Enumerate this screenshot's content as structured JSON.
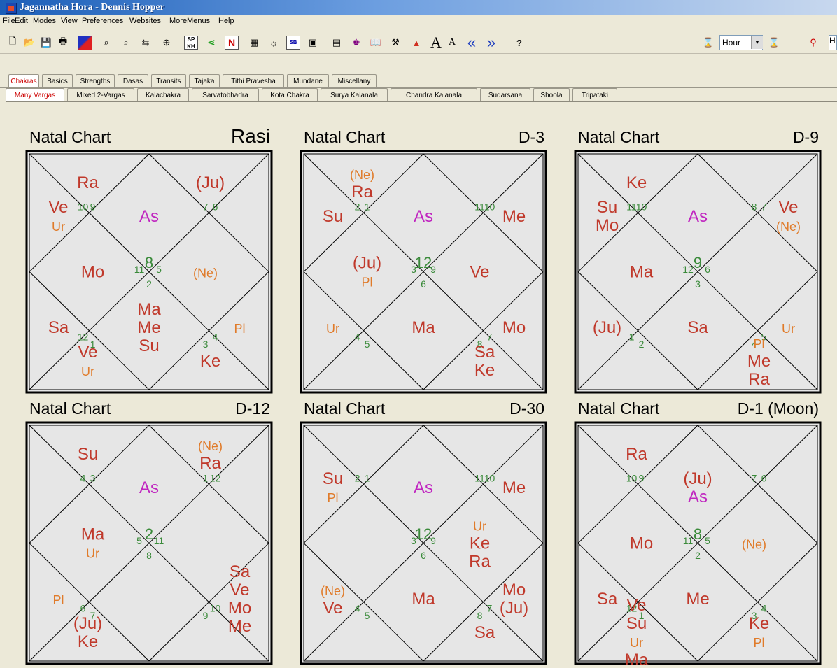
{
  "window": {
    "title": "Jagannatha Hora - Dennis Hopper"
  },
  "menu": [
    "File",
    "Edit",
    "Modes",
    "View",
    "Preferences",
    "Websites",
    "MoreMenus",
    "Help"
  ],
  "toolbar": {
    "hour_value": "Hour",
    "h_value": "H",
    "dropdown_arrow": "▼",
    "button_labels": {
      "sp": "SP",
      "kh": "KH",
      "n": "N",
      "sb": "SB",
      "a_large": "A",
      "a_small": "A",
      "prev": "«",
      "next": "»",
      "help": "?"
    }
  },
  "tabs_main": [
    "Chakras",
    "Basics",
    "Strengths",
    "Dasas",
    "Transits",
    "Tajaka",
    "Tithi Pravesha",
    "Mundane",
    "Miscellany"
  ],
  "tabs_sub": [
    "Many Vargas",
    "Mixed 2-Vargas",
    "Kalachakra",
    "Sarvatobhadra",
    "Kota Chakra",
    "Surya Kalanala",
    "Chandra Kalanala",
    "Sudarsana",
    "Shoola",
    "Tripataki"
  ],
  "active_main_tab": "Chakras",
  "active_sub_tab": "Many Vargas",
  "colors": {
    "planet": "#c0392b",
    "ascendant": "#c026c0",
    "outer_planet": "#e07b2a",
    "sign_number": "#3a8a3a",
    "chart_bg": "#e6e6e6"
  },
  "charts": [
    {
      "title": "Natal Chart",
      "label": "Rasi",
      "signs": [
        "10",
        "9",
        "7",
        "6",
        "11",
        "8",
        "5",
        "2",
        "12",
        "1",
        "4",
        "3"
      ],
      "houses": [
        {
          "p": [
            {
              "t": "As",
              "c": "asc"
            }
          ]
        },
        {
          "p": [
            {
              "t": "Ra"
            }
          ]
        },
        {
          "p": [
            {
              "t": "Ve"
            },
            {
              "t": "Ur",
              "c": "outer"
            }
          ]
        },
        {
          "p": [
            {
              "t": "Mo"
            }
          ]
        },
        {
          "p": [
            {
              "t": "Sa"
            }
          ]
        },
        {
          "p": [
            {
              "t": "Ve"
            },
            {
              "t": "Ur",
              "c": "outer"
            }
          ]
        },
        {
          "p": [
            {
              "t": "Ma"
            },
            {
              "t": "Me"
            },
            {
              "t": "Su"
            }
          ]
        },
        {
          "p": [
            {
              "t": "Ke"
            }
          ]
        },
        {
          "p": [
            {
              "t": "Pl",
              "c": "outer"
            }
          ]
        },
        {
          "p": [
            {
              "t": "(Ne)",
              "c": "outer"
            }
          ]
        },
        {
          "p": []
        },
        {
          "p": [
            {
              "t": "(Ju)"
            }
          ]
        }
      ]
    },
    {
      "title": "Natal Chart",
      "label": "D-3",
      "signs": [
        "2",
        "1",
        "11",
        "10",
        "3",
        "12",
        "9",
        "6",
        "4",
        "5",
        "7",
        "8"
      ],
      "houses": [
        {
          "p": [
            {
              "t": "As",
              "c": "asc"
            }
          ]
        },
        {
          "p": [
            {
              "t": "(Ne)",
              "c": "outer"
            },
            {
              "t": "Ra"
            }
          ]
        },
        {
          "p": [
            {
              "t": "Su"
            }
          ]
        },
        {
          "p": [
            {
              "t": "(Ju)"
            },
            {
              "t": "Pl",
              "c": "outer"
            }
          ]
        },
        {
          "p": [
            {
              "t": "Ur",
              "c": "outer"
            }
          ]
        },
        {
          "p": []
        },
        {
          "p": [
            {
              "t": "Ma"
            }
          ]
        },
        {
          "p": [
            {
              "t": "Sa"
            },
            {
              "t": "Ke"
            }
          ]
        },
        {
          "p": [
            {
              "t": "Mo"
            }
          ]
        },
        {
          "p": [
            {
              "t": "Ve"
            }
          ]
        },
        {
          "p": [
            {
              "t": "Me"
            }
          ]
        },
        {
          "p": []
        }
      ]
    },
    {
      "title": "Natal Chart",
      "label": "D-9",
      "signs": [
        "11",
        "10",
        "8",
        "7",
        "12",
        "9",
        "6",
        "3",
        "1",
        "2",
        "5",
        "4"
      ],
      "houses": [
        {
          "p": [
            {
              "t": "As",
              "c": "asc"
            }
          ]
        },
        {
          "p": [
            {
              "t": "Ke"
            }
          ]
        },
        {
          "p": [
            {
              "t": "Su"
            },
            {
              "t": "Mo"
            }
          ]
        },
        {
          "p": [
            {
              "t": "Ma"
            }
          ]
        },
        {
          "p": [
            {
              "t": "(Ju)"
            }
          ]
        },
        {
          "p": []
        },
        {
          "p": [
            {
              "t": "Sa"
            }
          ]
        },
        {
          "p": [
            {
              "t": "Pl",
              "c": "outer"
            },
            {
              "t": "Me"
            },
            {
              "t": "Ra"
            }
          ]
        },
        {
          "p": [
            {
              "t": "Ur",
              "c": "outer"
            }
          ]
        },
        {
          "p": []
        },
        {
          "p": [
            {
              "t": "Ve"
            },
            {
              "t": "(Ne)",
              "c": "outer"
            }
          ]
        },
        {
          "p": []
        }
      ]
    },
    {
      "title": "Natal Chart",
      "label": "D-12",
      "signs": [
        "4",
        "3",
        "1",
        "12",
        "5",
        "2",
        "11",
        "8",
        "6",
        "7",
        "10",
        "9"
      ],
      "houses": [
        {
          "p": [
            {
              "t": "As",
              "c": "asc"
            }
          ]
        },
        {
          "p": [
            {
              "t": "Su"
            }
          ]
        },
        {
          "p": []
        },
        {
          "p": [
            {
              "t": "Ma"
            },
            {
              "t": "Ur",
              "c": "outer"
            }
          ]
        },
        {
          "p": [
            {
              "t": "Pl",
              "c": "outer"
            }
          ]
        },
        {
          "p": [
            {
              "t": "(Ju)"
            },
            {
              "t": "Ke"
            }
          ]
        },
        {
          "p": []
        },
        {
          "p": []
        },
        {
          "p": [
            {
              "t": "Sa"
            },
            {
              "t": "Ve"
            },
            {
              "t": "Mo"
            },
            {
              "t": "Me"
            }
          ]
        },
        {
          "p": []
        },
        {
          "p": []
        },
        {
          "p": [
            {
              "t": "(Ne)",
              "c": "outer"
            },
            {
              "t": "Ra"
            }
          ]
        }
      ]
    },
    {
      "title": "Natal Chart",
      "label": "D-30",
      "signs": [
        "2",
        "1",
        "11",
        "10",
        "3",
        "12",
        "9",
        "6",
        "4",
        "5",
        "7",
        "8"
      ],
      "houses": [
        {
          "p": [
            {
              "t": "As",
              "c": "asc"
            }
          ]
        },
        {
          "p": []
        },
        {
          "p": [
            {
              "t": "Su"
            },
            {
              "t": "Pl",
              "c": "outer"
            }
          ]
        },
        {
          "p": []
        },
        {
          "p": [
            {
              "t": "(Ne)",
              "c": "outer"
            },
            {
              "t": "Ve"
            }
          ]
        },
        {
          "p": []
        },
        {
          "p": [
            {
              "t": "Ma"
            }
          ]
        },
        {
          "p": [
            {
              "t": "Sa"
            }
          ]
        },
        {
          "p": [
            {
              "t": "Mo"
            },
            {
              "t": "(Ju)"
            }
          ]
        },
        {
          "p": [
            {
              "t": "Ur",
              "c": "outer"
            },
            {
              "t": "Ke"
            },
            {
              "t": "Ra"
            }
          ]
        },
        {
          "p": [
            {
              "t": "Me"
            }
          ]
        },
        {
          "p": []
        }
      ]
    },
    {
      "title": "Natal Chart",
      "label": "D-1 (Moon)",
      "signs": [
        "10",
        "9",
        "7",
        "6",
        "11",
        "8",
        "5",
        "2",
        "12",
        "1",
        "4",
        "3"
      ],
      "houses": [
        {
          "p": [
            {
              "t": "(Ju)"
            },
            {
              "t": "As",
              "c": "asc"
            }
          ]
        },
        {
          "p": [
            {
              "t": "Ra"
            }
          ]
        },
        {
          "p": []
        },
        {
          "p": [
            {
              "t": "Mo"
            }
          ]
        },
        {
          "p": [
            {
              "t": "Sa"
            }
          ]
        },
        {
          "p": [
            {
              "t": "Ve"
            },
            {
              "t": "Su"
            },
            {
              "t": "Ur",
              "c": "outer"
            },
            {
              "t": "Ma"
            }
          ]
        },
        {
          "p": [
            {
              "t": "Me"
            }
          ]
        },
        {
          "p": [
            {
              "t": "Ke"
            },
            {
              "t": "Pl",
              "c": "outer"
            }
          ]
        },
        {
          "p": []
        },
        {
          "p": [
            {
              "t": "(Ne)",
              "c": "outer"
            }
          ]
        },
        {
          "p": []
        },
        {
          "p": []
        }
      ]
    }
  ]
}
